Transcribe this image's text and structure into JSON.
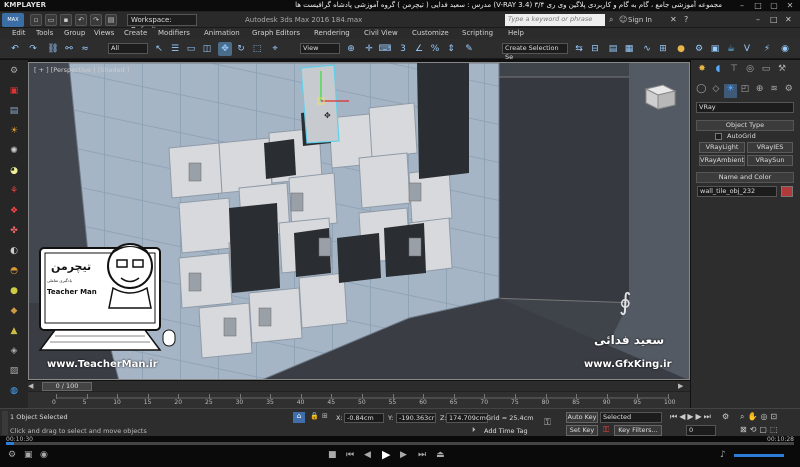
{
  "player": {
    "logo": "KMPLAYER",
    "title": "مجموعه آموزشی جامع ، گام به گام و کاربردی پلاگین وی ری ۳/۴  (V-RAY 3.4)  مدرس : سعید فدایی ( تیچرمن ) گروه آموزشی پادشاه گرافیست ها",
    "time_elapsed": "00:10:30",
    "time_total": "00:10:28",
    "progress": 0.01
  },
  "app": {
    "workspace": "Workspace: Default",
    "title": "Autodesk 3ds Max 2016  184.max",
    "search_placeholder": "Type a keyword or phrase",
    "signin": "Sign In",
    "max_logo": "MAX"
  },
  "menu": [
    "Edit",
    "Tools",
    "Group",
    "Views",
    "Create",
    "Modifiers",
    "Animation",
    "Graph Editors",
    "Rendering",
    "Civil View",
    "Customize",
    "Scripting",
    "Help"
  ],
  "toolbar": {
    "filter": "All",
    "refcoord": "View",
    "selset": "Create Selection Se"
  },
  "viewport": {
    "label": "[ + ] [Perspective ] [Shaded ]",
    "watermark_left": "www.TeacherMan.ir",
    "watermark_right": "www.GfxKing.ir",
    "teacher_name": "سعید فدائی",
    "logo_text": "تیچرمن",
    "logo_sub": "Teacher Man",
    "logo_sub2": "یادگیری تعاملی"
  },
  "cmdpanel": {
    "category": "VRay",
    "object_type_header": "Object Type",
    "autogrid": "AutoGrid",
    "buttons": [
      "VRayLight",
      "VRayIES",
      "VRayAmbientLight",
      "VRaySun"
    ],
    "name_color_header": "Name and Color",
    "object_name": "wall_tile_obj_232"
  },
  "timeline": {
    "frame": "0 / 100",
    "ticks": [
      "0",
      "5",
      "10",
      "15",
      "20",
      "25",
      "30",
      "35",
      "40",
      "45",
      "50",
      "55",
      "60",
      "65",
      "70",
      "75",
      "80",
      "85",
      "90",
      "95",
      "100"
    ]
  },
  "status": {
    "selected": "1 Object Selected",
    "prompt": "Click and drag to select and move objects",
    "x": "-0.84cm",
    "y": "-190.363cr",
    "z": "174.709cm",
    "grid": "Grid = 25.4cm",
    "add_time_tag": "Add Time Tag",
    "auto_key": "Auto Key",
    "auto_key_value": "Selected",
    "set_key": "Set Key",
    "key_filters": "Key Filters...",
    "current_frame": "0",
    "x_label": "X:",
    "y_label": "Y:",
    "z_label": "Z:"
  },
  "colors": {
    "accent": "#2c7cd8",
    "tile_light": "#c8cbd0",
    "tile_blue": "#8fa3b8",
    "selection": "#5fd0e8"
  }
}
